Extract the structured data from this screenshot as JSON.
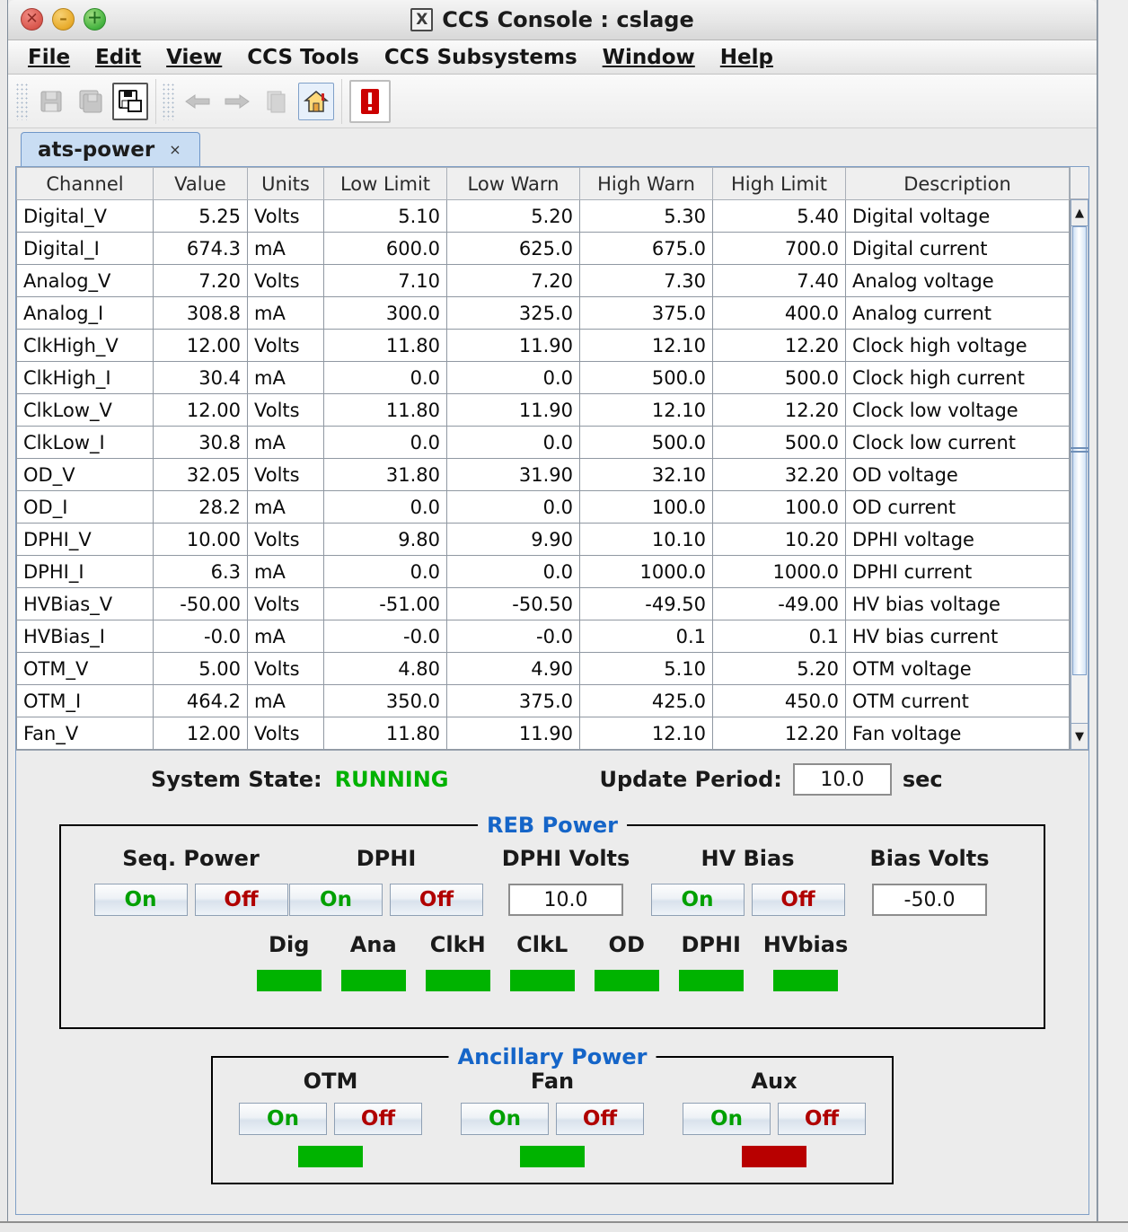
{
  "window": {
    "title": "CCS Console : cslage",
    "logo_glyph": "X",
    "controls": [
      {
        "name": "close",
        "glyph": "✕"
      },
      {
        "name": "minimize",
        "glyph": "–"
      },
      {
        "name": "maximize",
        "glyph": "＋"
      }
    ]
  },
  "menubar": {
    "items": [
      {
        "label": "File",
        "mnemonic": "F"
      },
      {
        "label": "Edit",
        "mnemonic": "E"
      },
      {
        "label": "View",
        "mnemonic": "V"
      },
      {
        "label": "CCS Tools",
        "mnemonic": ""
      },
      {
        "label": "CCS Subsystems",
        "mnemonic": ""
      },
      {
        "label": "Window",
        "mnemonic": "W"
      },
      {
        "label": "Help",
        "mnemonic": "H"
      }
    ]
  },
  "toolbar": {
    "buttons": [
      {
        "icon": "save-icon",
        "enabled": false
      },
      {
        "icon": "save-all-icon",
        "enabled": false
      },
      {
        "icon": "save-as-icon",
        "enabled": true
      },
      {
        "icon": "back-arrow-icon",
        "enabled": false
      },
      {
        "icon": "forward-arrow-icon",
        "enabled": false
      },
      {
        "icon": "refresh-icon",
        "enabled": false
      },
      {
        "icon": "home-icon",
        "enabled": true
      },
      {
        "icon": "alert-icon",
        "enabled": true
      }
    ]
  },
  "tabs": [
    {
      "label": "ats-power",
      "close_glyph": "×",
      "selected": true
    }
  ],
  "table": {
    "columns": [
      "Channel",
      "Value",
      "Units",
      "Low Limit",
      "Low Warn",
      "High Warn",
      "High Limit",
      "Description"
    ],
    "rows": [
      {
        "channel": "Digital_V",
        "value": "5.25",
        "status": "ok",
        "units": "Volts",
        "low_limit": "5.10",
        "low_warn": "5.20",
        "high_warn": "5.30",
        "high_limit": "5.40",
        "description": "Digital voltage"
      },
      {
        "channel": "Digital_I",
        "value": "674.3",
        "status": "ok",
        "units": "mA",
        "low_limit": "600.0",
        "low_warn": "625.0",
        "high_warn": "675.0",
        "high_limit": "700.0",
        "description": "Digital current"
      },
      {
        "channel": "Analog_V",
        "value": "7.20",
        "status": "warn",
        "units": "Volts",
        "low_limit": "7.10",
        "low_warn": "7.20",
        "high_warn": "7.30",
        "high_limit": "7.40",
        "description": "Analog voltage"
      },
      {
        "channel": "Analog_I",
        "value": "308.8",
        "status": "warn",
        "units": "mA",
        "low_limit": "300.0",
        "low_warn": "325.0",
        "high_warn": "375.0",
        "high_limit": "400.0",
        "description": "Analog current"
      },
      {
        "channel": "ClkHigh_V",
        "value": "12.00",
        "status": "ok",
        "units": "Volts",
        "low_limit": "11.80",
        "low_warn": "11.90",
        "high_warn": "12.10",
        "high_limit": "12.20",
        "description": "Clock high voltage"
      },
      {
        "channel": "ClkHigh_I",
        "value": "30.4",
        "status": "ok",
        "units": "mA",
        "low_limit": "0.0",
        "low_warn": "0.0",
        "high_warn": "500.0",
        "high_limit": "500.0",
        "description": "Clock high current"
      },
      {
        "channel": "ClkLow_V",
        "value": "12.00",
        "status": "ok",
        "units": "Volts",
        "low_limit": "11.80",
        "low_warn": "11.90",
        "high_warn": "12.10",
        "high_limit": "12.20",
        "description": "Clock low voltage"
      },
      {
        "channel": "ClkLow_I",
        "value": "30.8",
        "status": "ok",
        "units": "mA",
        "low_limit": "0.0",
        "low_warn": "0.0",
        "high_warn": "500.0",
        "high_limit": "500.0",
        "description": "Clock low current"
      },
      {
        "channel": "OD_V",
        "value": "32.05",
        "status": "ok",
        "units": "Volts",
        "low_limit": "31.80",
        "low_warn": "31.90",
        "high_warn": "32.10",
        "high_limit": "32.20",
        "description": "OD voltage"
      },
      {
        "channel": "OD_I",
        "value": "28.2",
        "status": "ok",
        "units": "mA",
        "low_limit": "0.0",
        "low_warn": "0.0",
        "high_warn": "100.0",
        "high_limit": "100.0",
        "description": "OD current"
      },
      {
        "channel": "DPHI_V",
        "value": "10.00",
        "status": "ok",
        "units": "Volts",
        "low_limit": "9.80",
        "low_warn": "9.90",
        "high_warn": "10.10",
        "high_limit": "10.20",
        "description": "DPHI voltage"
      },
      {
        "channel": "DPHI_I",
        "value": "6.3",
        "status": "ok",
        "units": "mA",
        "low_limit": "0.0",
        "low_warn": "0.0",
        "high_warn": "1000.0",
        "high_limit": "1000.0",
        "description": "DPHI current"
      },
      {
        "channel": "HVBias_V",
        "value": "-50.00",
        "status": "ok",
        "units": "Volts",
        "low_limit": "-51.00",
        "low_warn": "-50.50",
        "high_warn": "-49.50",
        "high_limit": "-49.00",
        "description": "HV bias voltage"
      },
      {
        "channel": "HVBias_I",
        "value": "-0.0",
        "status": "ok",
        "units": "mA",
        "low_limit": "-0.0",
        "low_warn": "-0.0",
        "high_warn": "0.1",
        "high_limit": "0.1",
        "description": "HV bias current"
      },
      {
        "channel": "OTM_V",
        "value": "5.00",
        "status": "ok",
        "units": "Volts",
        "low_limit": "4.80",
        "low_warn": "4.90",
        "high_warn": "5.10",
        "high_limit": "5.20",
        "description": "OTM voltage"
      },
      {
        "channel": "OTM_I",
        "value": "464.2",
        "status": "alarm",
        "units": "mA",
        "low_limit": "350.0",
        "low_warn": "375.0",
        "high_warn": "425.0",
        "high_limit": "450.0",
        "description": "OTM current"
      },
      {
        "channel": "Fan_V",
        "value": "12.00",
        "status": "ok",
        "units": "Volts",
        "low_limit": "11.80",
        "low_warn": "11.90",
        "high_warn": "12.10",
        "high_limit": "12.20",
        "description": "Fan voltage"
      }
    ],
    "scrollbar": {
      "up_glyph": "▲",
      "down_glyph": "▼"
    }
  },
  "status": {
    "system_state_label": "System State:",
    "system_state_value": "RUNNING",
    "update_period_label": "Update Period:",
    "update_period_value": "10.0",
    "update_period_unit": "sec"
  },
  "reb_power": {
    "title": "REB Power",
    "columns": [
      {
        "header": "Seq. Power",
        "type": "onoff",
        "on": "On",
        "off": "Off"
      },
      {
        "header": "DPHI",
        "type": "onoff",
        "on": "On",
        "off": "Off"
      },
      {
        "header": "DPHI Volts",
        "type": "field",
        "value": "10.0"
      },
      {
        "header": "HV Bias",
        "type": "onoff",
        "on": "On",
        "off": "Off"
      },
      {
        "header": "Bias Volts",
        "type": "field",
        "value": "-50.0"
      }
    ],
    "leds": [
      {
        "label": "Dig",
        "state": "green"
      },
      {
        "label": "Ana",
        "state": "green"
      },
      {
        "label": "ClkH",
        "state": "green"
      },
      {
        "label": "ClkL",
        "state": "green"
      },
      {
        "label": "OD",
        "state": "green"
      },
      {
        "label": "DPHI",
        "state": "green"
      },
      {
        "label": "HVbias",
        "state": "green"
      }
    ]
  },
  "ancillary_power": {
    "title": "Ancillary Power",
    "columns": [
      {
        "header": "OTM",
        "on": "On",
        "off": "Off",
        "state": "green"
      },
      {
        "header": "Fan",
        "on": "On",
        "off": "Off",
        "state": "green"
      },
      {
        "header": "Aux",
        "on": "On",
        "off": "Off",
        "state": "red"
      }
    ]
  },
  "colors": {
    "ok": "#98f098",
    "warn": "#fbf552",
    "alarm": "#f7a8a0",
    "led_green": "#00b300",
    "led_red": "#b80000",
    "running_text": "#00b200",
    "group_title": "#1565c8",
    "on_text": "#00a000",
    "off_text": "#b00000"
  }
}
